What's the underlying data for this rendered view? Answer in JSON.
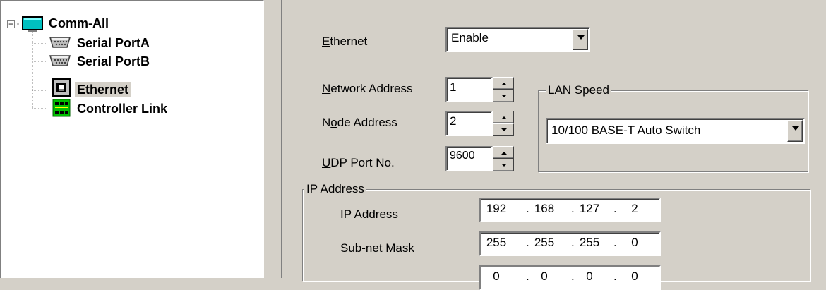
{
  "tree": {
    "expander": "−",
    "root": {
      "label": "Comm-All",
      "icon": "monitor-icon"
    },
    "children": [
      {
        "label": "Serial PortA",
        "icon": "serial-port-icon",
        "selected": false
      },
      {
        "label": "Serial PortB",
        "icon": "serial-port-icon",
        "selected": false
      },
      {
        "label": "Ethernet",
        "icon": "ethernet-port-icon",
        "selected": true
      },
      {
        "label": "Controller Link",
        "icon": "controller-link-icon",
        "selected": false
      }
    ]
  },
  "form": {
    "ethernet": {
      "label_mnemonic": "E",
      "label_rest": "thernet",
      "value": "Enable"
    },
    "network_address": {
      "label_mnemonic": "N",
      "label_rest": "etwork Address",
      "value": "1"
    },
    "node_address": {
      "label_pre": "N",
      "label_mnemonic": "o",
      "label_rest": "de Address",
      "value": "2"
    },
    "udp_port": {
      "label_mnemonic": "U",
      "label_rest": "DP Port No.",
      "value": "9600"
    },
    "lan_speed": {
      "legend_pre": "LAN S",
      "legend_mnemonic": "p",
      "legend_rest": "eed",
      "value": "10/100 BASE-T Auto Switch"
    },
    "ip_group": {
      "legend": "IP Address",
      "ip_address": {
        "label_mnemonic": "I",
        "label_rest": "P Address",
        "octets": [
          "192",
          "168",
          "127",
          "2"
        ]
      },
      "subnet_mask": {
        "label_mnemonic": "S",
        "label_rest": "ub-net Mask",
        "octets": [
          "255",
          "255",
          "255",
          "0"
        ]
      },
      "third_row": {
        "octets": [
          "0",
          "0",
          "0",
          "0"
        ]
      }
    }
  },
  "colors": {
    "face": "#d4d0c8",
    "shadow": "#808080",
    "highlight": "#ffffff",
    "dark": "#404040"
  }
}
